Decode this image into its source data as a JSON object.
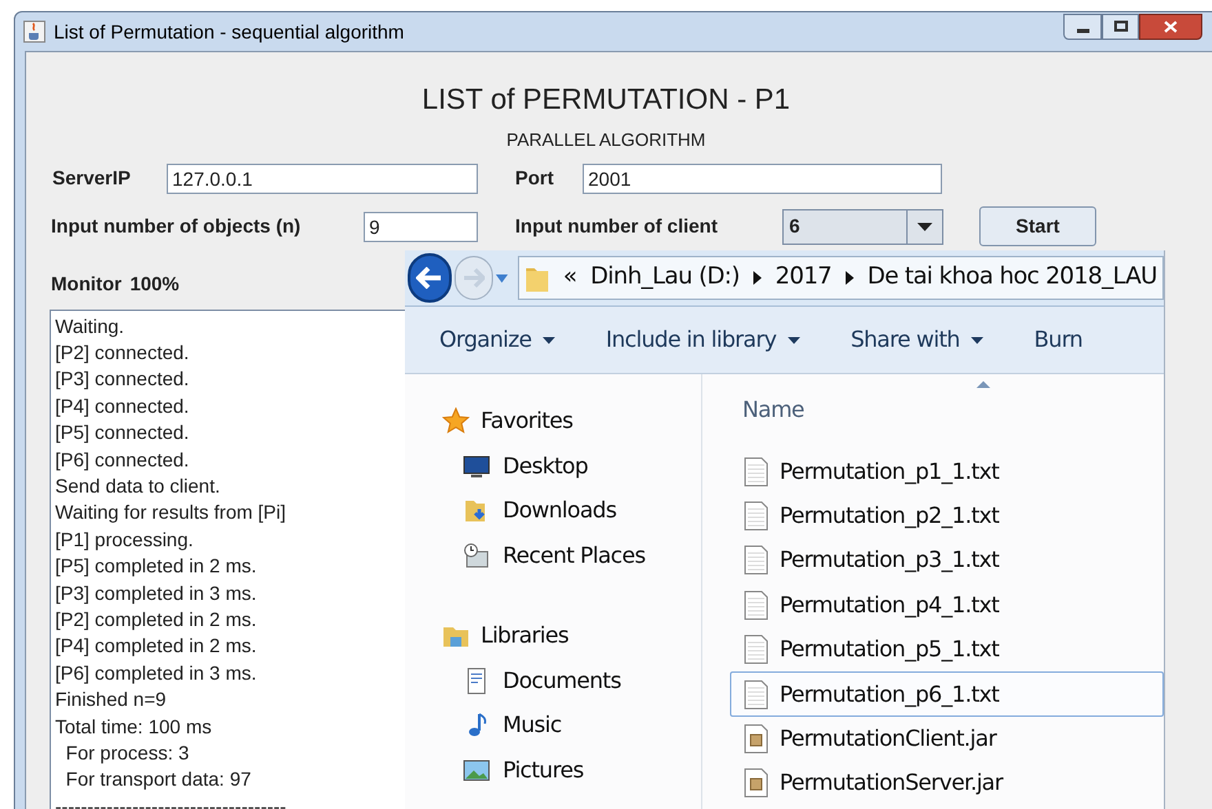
{
  "java_window": {
    "title": "List of Permutation - sequential algorithm",
    "heading": "LIST of PERMUTATION - P1",
    "subheading": "PARALLEL ALGORITHM",
    "server_ip": {
      "label": "ServerIP",
      "value": "127.0.0.1"
    },
    "port": {
      "label": "Port",
      "value": "2001"
    },
    "objects": {
      "label": "Input number of objects (n)",
      "value": "9"
    },
    "clients": {
      "label": "Input number of client",
      "value": "6"
    },
    "start_button": "Start",
    "monitor": {
      "label": "Monitor",
      "percent": "100%"
    },
    "log": [
      "Waiting.",
      "[P2] connected.",
      "[P3] connected.",
      "[P4] connected.",
      "[P5] connected.",
      "[P6] connected.",
      "Send data to client.",
      "Waiting for results from [Pi]",
      "[P1] processing.",
      "[P5] completed in 2 ms.",
      "[P3] completed in 3 ms.",
      "[P2] completed in 2 ms.",
      "[P4] completed in 2 ms.",
      "[P6] completed in 3 ms.",
      "Finished n=9",
      "Total time: 100 ms",
      "  For process: 3",
      "  For transport data: 97",
      "------------------------------------"
    ]
  },
  "explorer": {
    "overflow": "«",
    "breadcrumb": [
      "Dinh_Lau (D:)",
      "2017",
      "De tai khoa hoc 2018_LAU"
    ],
    "toolbar": [
      {
        "label": "Organize",
        "menu": true
      },
      {
        "label": "Include in library",
        "menu": true
      },
      {
        "label": "Share with",
        "menu": true
      },
      {
        "label": "Burn",
        "menu": false
      }
    ],
    "nav": [
      {
        "label": "Favorites",
        "kind": "star",
        "children": [
          {
            "label": "Desktop",
            "kind": "desktop"
          },
          {
            "label": "Downloads",
            "kind": "downloads"
          },
          {
            "label": "Recent Places",
            "kind": "recent"
          }
        ]
      },
      {
        "label": "Libraries",
        "kind": "libraries",
        "children": [
          {
            "label": "Documents",
            "kind": "documents"
          },
          {
            "label": "Music",
            "kind": "music"
          },
          {
            "label": "Pictures",
            "kind": "pictures"
          }
        ]
      }
    ],
    "column": "Name",
    "files": [
      {
        "name": "Permutation_p1_1.txt",
        "kind": "text",
        "selected": false
      },
      {
        "name": "Permutation_p2_1.txt",
        "kind": "text",
        "selected": false
      },
      {
        "name": "Permutation_p3_1.txt",
        "kind": "text",
        "selected": false
      },
      {
        "name": "Permutation_p4_1.txt",
        "kind": "text",
        "selected": false
      },
      {
        "name": "Permutation_p5_1.txt",
        "kind": "text",
        "selected": false
      },
      {
        "name": "Permutation_p6_1.txt",
        "kind": "text",
        "selected": true
      },
      {
        "name": "PermutationClient.jar",
        "kind": "jar",
        "selected": false
      },
      {
        "name": "PermutationServer.jar",
        "kind": "jar",
        "selected": false
      }
    ]
  }
}
